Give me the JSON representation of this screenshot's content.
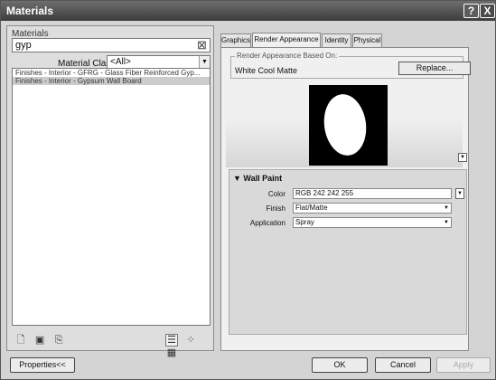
{
  "window": {
    "title": "Materials",
    "help_label": "?",
    "close_label": "X"
  },
  "left": {
    "group_label": "Materials",
    "search_value": "gyp",
    "clear_icon": "x-icon",
    "material_class_label": "Material Class:",
    "material_class_value": "<All>",
    "materials": [
      "Finishes - Interior - GFRG - Glass Fiber Reinforced Gyp...",
      "Finishes - Interior - Gypsum Wall Board"
    ],
    "selected_index": 1
  },
  "tabs": [
    "Graphics",
    "Render Appearance",
    "Identity",
    "Physical"
  ],
  "active_tab": 1,
  "render": {
    "based_on_label": "Render Appearance Based On:",
    "based_on_value": "White Cool Matte",
    "replace_label": "Replace..."
  },
  "wall_paint": {
    "header": "Wall Paint",
    "color_label": "Color",
    "color_value": "RGB 242 242 255",
    "finish_label": "Finish",
    "finish_value": "Flat/Matte",
    "application_label": "Application",
    "application_value": "Spray"
  },
  "footer": {
    "properties_label": "Properties<<",
    "ok_label": "OK",
    "cancel_label": "Cancel",
    "apply_label": "Apply"
  }
}
